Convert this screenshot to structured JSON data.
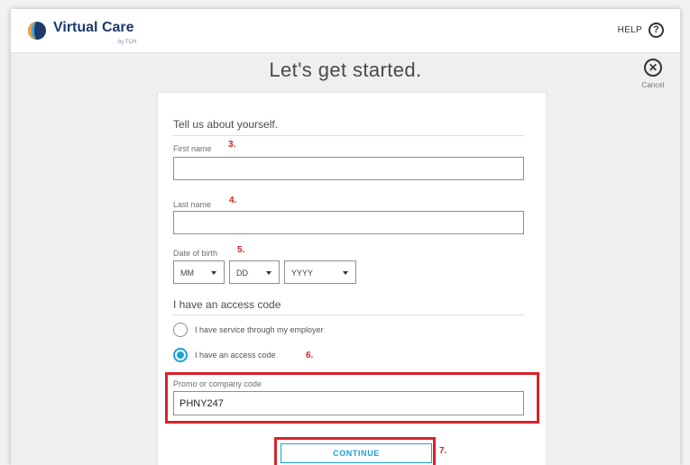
{
  "app": {
    "logo_name": "Virtual Care",
    "logo_sub": "by TCH",
    "help_label": "HELP",
    "help_icon_glyph": "?"
  },
  "page": {
    "title": "Let's get started.",
    "cancel_label": "Cancel",
    "cancel_icon_glyph": "✕"
  },
  "form": {
    "section_title": "Tell us about yourself.",
    "first_name": {
      "label": "First name",
      "value": "",
      "step": "3."
    },
    "last_name": {
      "label": "Last name",
      "value": "",
      "step": "4."
    },
    "dob": {
      "label": "Date of birth",
      "step": "5.",
      "month": "MM",
      "day": "DD",
      "year": "YYYY"
    },
    "access": {
      "section_title": "I have an access code",
      "options": [
        {
          "label": "I have service through my employer",
          "checked": false
        },
        {
          "label": "I have an access code",
          "checked": true
        }
      ],
      "step": "6."
    },
    "promo": {
      "label": "Promo or company code",
      "value": "PHNY247"
    },
    "continue_label": "CONTINUE",
    "continue_step": "7."
  },
  "colors": {
    "accent": "#1ba3dc",
    "annotation_red": "#d62020",
    "brand_navy": "#1b3a6b"
  },
  "icons": [
    "virtual-care-logo-icon",
    "help-icon",
    "cancel-icon",
    "chevron-down-icon",
    "radio-icon"
  ]
}
